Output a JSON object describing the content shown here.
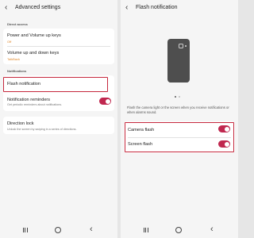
{
  "left": {
    "header": {
      "title": "Advanced settings"
    },
    "section_direct": "Direct access",
    "items": [
      {
        "title": "Power and Volume up keys",
        "sub": "Off"
      },
      {
        "title": "Volume up and down keys",
        "sub": "TalkBack"
      }
    ],
    "section_notifications": "Notifications",
    "flash_notification": {
      "title": "Flash notification"
    },
    "notification_reminders": {
      "title": "Notification reminders",
      "desc": "Get periodic reminders about notifications.",
      "enabled": true
    },
    "direction_lock": {
      "title": "Direction lock",
      "desc": "Unlock the screen by swiping in a series of directions."
    }
  },
  "right": {
    "header": {
      "title": "Flash notification"
    },
    "info_text": "Flash the camera light or the screen when you receive notifications or when alarms sound.",
    "camera_flash": {
      "label": "Camera flash",
      "enabled": true
    },
    "screen_flash": {
      "label": "Screen flash",
      "enabled": true
    }
  },
  "colors": {
    "accent": "#c0284f",
    "highlight": "#c5283d",
    "subtext": "#e08a2e"
  }
}
